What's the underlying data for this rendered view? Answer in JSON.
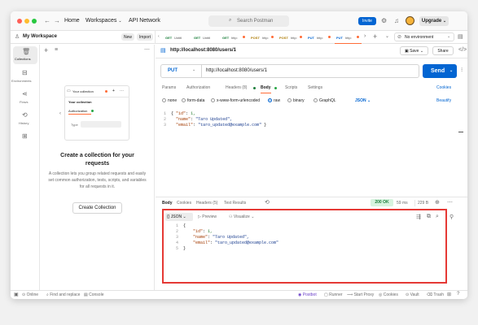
{
  "titlebar": {
    "nav_home": "Home",
    "nav_workspaces": "Workspaces",
    "nav_api_network": "API Network",
    "search_placeholder": "Search Postman",
    "invite": "Invite",
    "upgrade": "Upgrade"
  },
  "sidebar": {
    "workspace": "My Workspace",
    "new_btn": "New",
    "import_btn": "Import",
    "rail": [
      {
        "icon": "collections-icon",
        "label": "Collections"
      },
      {
        "icon": "environments-icon",
        "label": "Environments"
      },
      {
        "icon": "flows-icon",
        "label": "Flows"
      },
      {
        "icon": "history-icon",
        "label": "History"
      },
      {
        "icon": "grid-icon",
        "label": ""
      }
    ],
    "illus": {
      "collection": "Your collection",
      "title": "Your collection",
      "auth": "Authorization",
      "type": "Type"
    },
    "heading": "Create a collection for your requests",
    "body": "A collection lets you group related requests and easily set common authorization, tests, scripts, and variables for all requests in it.",
    "create_btn": "Create Collection"
  },
  "tabs": [
    {
      "method": "GET",
      "label": "Untitl"
    },
    {
      "method": "GET",
      "label": "Untitl"
    },
    {
      "method": "GET",
      "label": "http:"
    },
    {
      "method": "POST",
      "label": "http:"
    },
    {
      "method": "POST",
      "label": "http:"
    },
    {
      "method": "PUT",
      "label": "http:"
    },
    {
      "method": "PUT",
      "label": "http:"
    }
  ],
  "env": "No environment",
  "request": {
    "title": "http://localhost:8080/users/1",
    "save": "Save",
    "share": "Share",
    "method": "PUT",
    "url": "http://localhost:8080/users/1",
    "send": "Send",
    "cookies": "Cookies",
    "subtabs": [
      "Params",
      "Authorization",
      "Headers (8)",
      "Body",
      "Scripts",
      "Settings"
    ],
    "body_modes": [
      "none",
      "form-data",
      "x-www-form-urlencoded",
      "raw",
      "binary",
      "GraphQL"
    ],
    "body_lang": "JSON",
    "beautify": "Beautify",
    "body_lines": [
      "1",
      "2",
      "3"
    ],
    "body_key1": "\"id\"",
    "body_val1": "1,",
    "body_key2": "\"name\"",
    "body_val2": "\"Taro Updated\",",
    "body_key3": "\"email\"",
    "body_val3": "\"taro_updated@example.com\""
  },
  "response": {
    "tabs": [
      "Body",
      "Cookies",
      "Headers (5)",
      "Test Results"
    ],
    "status": "200 OK",
    "time": "59 ms",
    "size": "229 B",
    "format": "JSON",
    "preview": "Preview",
    "visualize": "Visualize",
    "lines": [
      "1",
      "2",
      "3",
      "4",
      "5"
    ],
    "key1": "\"id\"",
    "val1": "1,",
    "key2": "\"name\"",
    "val2": "\"Taro Updated\",",
    "key3": "\"email\"",
    "val3": "\"taro_updated@example.com\""
  },
  "statusbar": {
    "online": "Online",
    "find": "Find and replace",
    "console": "Console",
    "postbot": "Postbot",
    "runner": "Runner",
    "proxy": "Start Proxy",
    "cookies": "Cookies",
    "vault": "Vault",
    "trash": "Trash"
  },
  "colors": {
    "accent": "#0265d2",
    "orange": "#ff6c37",
    "highlight": "#e53935",
    "ok": "#1b7f3b"
  }
}
